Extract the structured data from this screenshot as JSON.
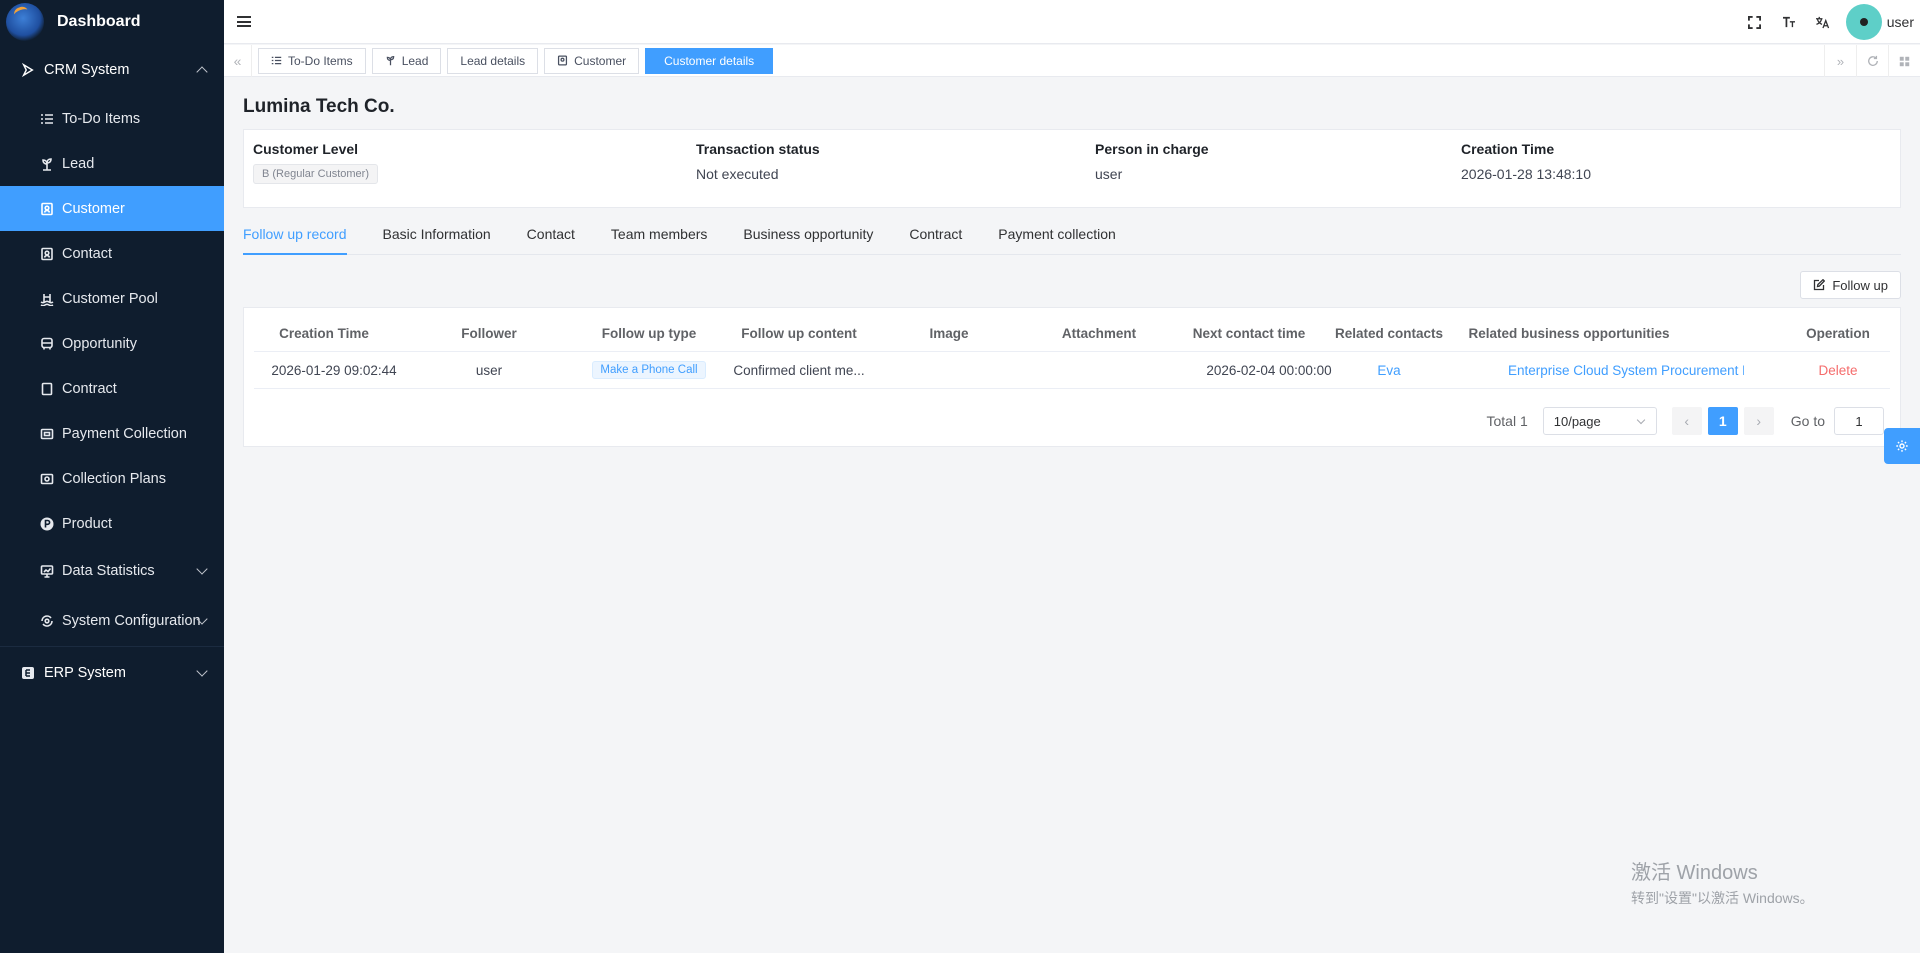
{
  "sidebar": {
    "title": "Dashboard",
    "crm": {
      "label": "CRM System"
    },
    "items": [
      {
        "label": "To-Do Items",
        "icon": "list-icon"
      },
      {
        "label": "Lead",
        "icon": "sprout-icon"
      },
      {
        "label": "Customer",
        "icon": "badge-icon"
      },
      {
        "label": "Contact",
        "icon": "contact-icon"
      },
      {
        "label": "Customer Pool",
        "icon": "pool-icon"
      },
      {
        "label": "Opportunity",
        "icon": "bus-icon"
      },
      {
        "label": "Contract",
        "icon": "document-icon"
      },
      {
        "label": "Payment Collection",
        "icon": "payment-icon"
      },
      {
        "label": "Collection Plans",
        "icon": "plan-icon"
      },
      {
        "label": "Product",
        "icon": "product-icon"
      },
      {
        "label": "Data Statistics",
        "icon": "chart-icon"
      },
      {
        "label": "System Configuration",
        "icon": "config-icon"
      }
    ],
    "erp": {
      "label": "ERP System"
    },
    "active_color": "#409eff",
    "bg_color": "#0f1d2e"
  },
  "header": {
    "username": "user",
    "icons": [
      "fullscreen-icon",
      "font-size-icon",
      "translate-icon"
    ]
  },
  "tags": [
    {
      "label": "To-Do Items"
    },
    {
      "label": "Lead"
    },
    {
      "label": "Lead details"
    },
    {
      "label": "Customer"
    },
    {
      "label": "Customer details"
    }
  ],
  "customer": {
    "name": "Lumina Tech Co.",
    "level_label": "Customer Level",
    "level_value": "B (Regular Customer)",
    "status_label": "Transaction status",
    "status_value": "Not executed",
    "person_label": "Person in charge",
    "person_value": "user",
    "created_label": "Creation Time",
    "created_value": "2026-01-28 13:48:10"
  },
  "tabs": [
    "Follow up record",
    "Basic Information",
    "Contact",
    "Team members",
    "Business opportunity",
    "Contract",
    "Payment collection"
  ],
  "follow_button": "Follow up",
  "table": {
    "headers": [
      "Creation Time",
      "Follower",
      "Follow up type",
      "Follow up content",
      "Image",
      "Attachment",
      "Next contact time",
      "Related contacts",
      "Related business opportunities",
      "Operation"
    ],
    "rows": [
      {
        "creation_time": "2026-01-29 09:02:44",
        "follower": "user",
        "type": "Make a Phone Call",
        "content": "Confirmed client me...",
        "image": "",
        "attachment": "",
        "next_contact": "2026-02-04 00:00:00",
        "contacts": "Eva",
        "opportunity": "Enterprise Cloud System Procurement P",
        "operation": "Delete"
      }
    ]
  },
  "pagination": {
    "total": "Total 1",
    "page_size": "10/page",
    "current_page": "1",
    "goto_label": "Go to",
    "goto_value": "1"
  },
  "watermark": {
    "line1": "激活 Windows",
    "line2": "转到\"设置\"以激活 Windows。"
  }
}
